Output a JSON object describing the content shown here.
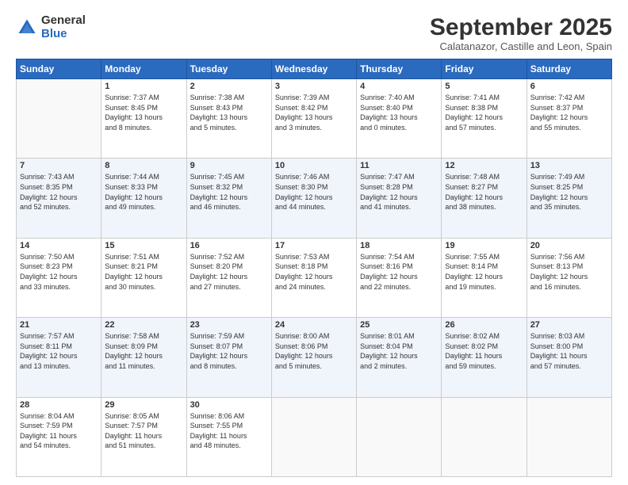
{
  "logo": {
    "general": "General",
    "blue": "Blue"
  },
  "title": "September 2025",
  "subtitle": "Calatanazor, Castille and Leon, Spain",
  "headers": [
    "Sunday",
    "Monday",
    "Tuesday",
    "Wednesday",
    "Thursday",
    "Friday",
    "Saturday"
  ],
  "weeks": [
    [
      {
        "day": "",
        "info": ""
      },
      {
        "day": "1",
        "info": "Sunrise: 7:37 AM\nSunset: 8:45 PM\nDaylight: 13 hours\nand 8 minutes."
      },
      {
        "day": "2",
        "info": "Sunrise: 7:38 AM\nSunset: 8:43 PM\nDaylight: 13 hours\nand 5 minutes."
      },
      {
        "day": "3",
        "info": "Sunrise: 7:39 AM\nSunset: 8:42 PM\nDaylight: 13 hours\nand 3 minutes."
      },
      {
        "day": "4",
        "info": "Sunrise: 7:40 AM\nSunset: 8:40 PM\nDaylight: 13 hours\nand 0 minutes."
      },
      {
        "day": "5",
        "info": "Sunrise: 7:41 AM\nSunset: 8:38 PM\nDaylight: 12 hours\nand 57 minutes."
      },
      {
        "day": "6",
        "info": "Sunrise: 7:42 AM\nSunset: 8:37 PM\nDaylight: 12 hours\nand 55 minutes."
      }
    ],
    [
      {
        "day": "7",
        "info": "Sunrise: 7:43 AM\nSunset: 8:35 PM\nDaylight: 12 hours\nand 52 minutes."
      },
      {
        "day": "8",
        "info": "Sunrise: 7:44 AM\nSunset: 8:33 PM\nDaylight: 12 hours\nand 49 minutes."
      },
      {
        "day": "9",
        "info": "Sunrise: 7:45 AM\nSunset: 8:32 PM\nDaylight: 12 hours\nand 46 minutes."
      },
      {
        "day": "10",
        "info": "Sunrise: 7:46 AM\nSunset: 8:30 PM\nDaylight: 12 hours\nand 44 minutes."
      },
      {
        "day": "11",
        "info": "Sunrise: 7:47 AM\nSunset: 8:28 PM\nDaylight: 12 hours\nand 41 minutes."
      },
      {
        "day": "12",
        "info": "Sunrise: 7:48 AM\nSunset: 8:27 PM\nDaylight: 12 hours\nand 38 minutes."
      },
      {
        "day": "13",
        "info": "Sunrise: 7:49 AM\nSunset: 8:25 PM\nDaylight: 12 hours\nand 35 minutes."
      }
    ],
    [
      {
        "day": "14",
        "info": "Sunrise: 7:50 AM\nSunset: 8:23 PM\nDaylight: 12 hours\nand 33 minutes."
      },
      {
        "day": "15",
        "info": "Sunrise: 7:51 AM\nSunset: 8:21 PM\nDaylight: 12 hours\nand 30 minutes."
      },
      {
        "day": "16",
        "info": "Sunrise: 7:52 AM\nSunset: 8:20 PM\nDaylight: 12 hours\nand 27 minutes."
      },
      {
        "day": "17",
        "info": "Sunrise: 7:53 AM\nSunset: 8:18 PM\nDaylight: 12 hours\nand 24 minutes."
      },
      {
        "day": "18",
        "info": "Sunrise: 7:54 AM\nSunset: 8:16 PM\nDaylight: 12 hours\nand 22 minutes."
      },
      {
        "day": "19",
        "info": "Sunrise: 7:55 AM\nSunset: 8:14 PM\nDaylight: 12 hours\nand 19 minutes."
      },
      {
        "day": "20",
        "info": "Sunrise: 7:56 AM\nSunset: 8:13 PM\nDaylight: 12 hours\nand 16 minutes."
      }
    ],
    [
      {
        "day": "21",
        "info": "Sunrise: 7:57 AM\nSunset: 8:11 PM\nDaylight: 12 hours\nand 13 minutes."
      },
      {
        "day": "22",
        "info": "Sunrise: 7:58 AM\nSunset: 8:09 PM\nDaylight: 12 hours\nand 11 minutes."
      },
      {
        "day": "23",
        "info": "Sunrise: 7:59 AM\nSunset: 8:07 PM\nDaylight: 12 hours\nand 8 minutes."
      },
      {
        "day": "24",
        "info": "Sunrise: 8:00 AM\nSunset: 8:06 PM\nDaylight: 12 hours\nand 5 minutes."
      },
      {
        "day": "25",
        "info": "Sunrise: 8:01 AM\nSunset: 8:04 PM\nDaylight: 12 hours\nand 2 minutes."
      },
      {
        "day": "26",
        "info": "Sunrise: 8:02 AM\nSunset: 8:02 PM\nDaylight: 11 hours\nand 59 minutes."
      },
      {
        "day": "27",
        "info": "Sunrise: 8:03 AM\nSunset: 8:00 PM\nDaylight: 11 hours\nand 57 minutes."
      }
    ],
    [
      {
        "day": "28",
        "info": "Sunrise: 8:04 AM\nSunset: 7:59 PM\nDaylight: 11 hours\nand 54 minutes."
      },
      {
        "day": "29",
        "info": "Sunrise: 8:05 AM\nSunset: 7:57 PM\nDaylight: 11 hours\nand 51 minutes."
      },
      {
        "day": "30",
        "info": "Sunrise: 8:06 AM\nSunset: 7:55 PM\nDaylight: 11 hours\nand 48 minutes."
      },
      {
        "day": "",
        "info": ""
      },
      {
        "day": "",
        "info": ""
      },
      {
        "day": "",
        "info": ""
      },
      {
        "day": "",
        "info": ""
      }
    ]
  ]
}
